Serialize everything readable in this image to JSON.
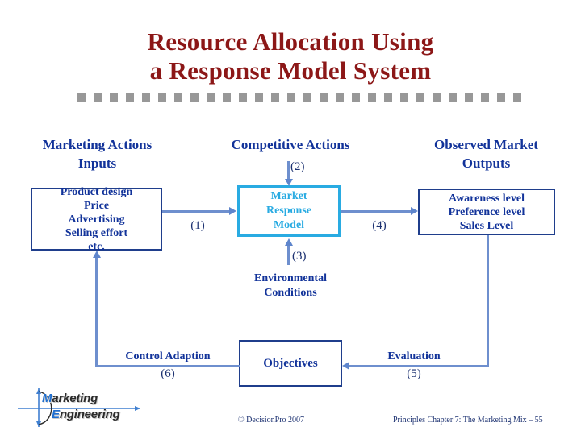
{
  "slide": {
    "title_line1": "Resource Allocation Using",
    "title_line2": "a Response Model System",
    "title_color": "#8C1717",
    "accent_navy": "#12339A",
    "accent_cyan": "#29ABE2",
    "arrow_color": "#6E8FCE",
    "divider_color": "#989898"
  },
  "columns": {
    "marketing": "Marketing Actions\nInputs",
    "competitive": "Competitive Actions",
    "observed": "Observed Market\nOutputs"
  },
  "boxes": {
    "inputs": "Product design\nPrice\nAdvertising\nSelling effort\netc.",
    "market_response_model": "Market\nResponse\nModel",
    "observed_outputs": "Awareness level\nPreference level\nSales Level",
    "objectives": "Objectives"
  },
  "labels": {
    "environmental_conditions": "Environmental\nConditions",
    "control_adaption": "Control Adaption",
    "evaluation": "Evaluation"
  },
  "steps": {
    "s1": "(1)",
    "s2": "(2)",
    "s3": "(3)",
    "s4": "(4)",
    "s5": "(5)",
    "s6": "(6)"
  },
  "logo": {
    "word1_cap": "M",
    "word1_rest": "arketing",
    "word2_cap": "E",
    "word2_rest": "ngineering"
  },
  "footer": {
    "copyright": "©  DecisionPro 2007",
    "reference": "Principles Chapter 7: The Marketing Mix – 55"
  }
}
